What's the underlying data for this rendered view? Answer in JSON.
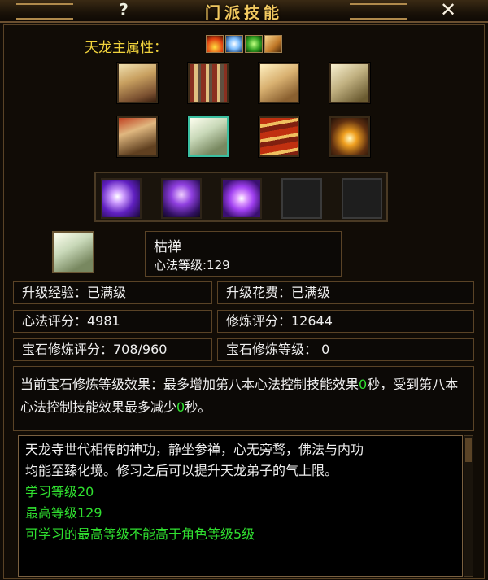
{
  "window": {
    "title": "门派技能",
    "help_label": "?",
    "close_label": "✕"
  },
  "attributes": {
    "label": "天龙主属性：",
    "icons": [
      "fire-icon",
      "ice-icon",
      "poison-icon",
      "neutral-icon"
    ]
  },
  "books": [
    "scroll-book-1",
    "scroll-bundle-book",
    "open-book-3",
    "open-book-4",
    "figure-book-5",
    "white-book-6",
    "red-books-7",
    "glowing-book-8"
  ],
  "skills": [
    "purple-burst-skill",
    "shadow-figure-skill",
    "purple-orb-skill",
    "empty-slot",
    "empty-slot"
  ],
  "selected_skill": {
    "name": "枯禅",
    "level": "心法等级:129"
  },
  "stats": {
    "upgrade_exp": "升级经验：已满级",
    "upgrade_cost": "升级花费：已满级",
    "xinfa_score": "心法评分：4981",
    "xiulian_score": "修炼评分：12644",
    "gem_score": "宝石修炼评分：708/960",
    "gem_level": "宝石修炼等级： 0"
  },
  "effect": {
    "text_a": "当前宝石修炼等级效果：最多增加第八本心法控制技能效果",
    "value_a": "0",
    "text_b": "秒，受到第八本心法控制技能效果最多减少",
    "value_b": "0",
    "text_c": "秒。"
  },
  "description": {
    "line1": "天龙寺世代相传的神功，静坐参禅，心无旁骛，佛法与内功",
    "line2": "均能至臻化境。修习之后可以提升天龙弟子的气上限。",
    "learn_level": "学习等级20",
    "max_level": "最高等级129",
    "note": "可学习的最高等级不能高于角色等级5级"
  },
  "colors": {
    "gold_text": "#f0d23c",
    "green_text": "#30e030",
    "border": "#5a4326",
    "selected_border": "#3bbfa0"
  }
}
